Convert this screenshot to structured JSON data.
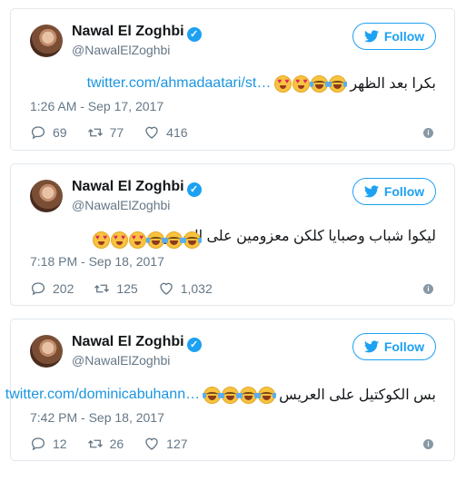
{
  "tweets": [
    {
      "name": "Nawal El Zoghbi",
      "handle": "@NawalElZoghbi",
      "follow_label": "Follow",
      "link": "twitter.com/ahmadaatari/st…",
      "text": "بكرا بعد الظهر",
      "emojis": [
        "heart-eyes-emoji",
        "heart-eyes-emoji",
        "tears-of-joy-emoji",
        "tears-of-joy-emoji"
      ],
      "time": "1:26 AM - Sep 17, 2017",
      "replies": "69",
      "retweets": "77",
      "likes": "416"
    },
    {
      "name": "Nawal El Zoghbi",
      "handle": "@NawalElZoghbi",
      "follow_label": "Follow",
      "link": "",
      "text": "ليكوا شباب وصبايا كلكن معزومين على العرس",
      "emojis": [
        "heart-eyes-emoji",
        "heart-eyes-emoji",
        "heart-eyes-emoji",
        "tears-of-joy-emoji",
        "tears-of-joy-emoji",
        "tears-of-joy-emoji"
      ],
      "time": "7:18 PM - Sep 18, 2017",
      "replies": "202",
      "retweets": "125",
      "likes": "1,032"
    },
    {
      "name": "Nawal El Zoghbi",
      "handle": "@NawalElZoghbi",
      "follow_label": "Follow",
      "link": "twitter.com/dominicabuhann…",
      "text": "بس الكوكتيل على العريس",
      "emojis": [
        "tears-of-joy-emoji",
        "tears-of-joy-emoji",
        "tears-of-joy-emoji",
        "tears-of-joy-emoji"
      ],
      "time": "7:42 PM - Sep 18, 2017",
      "replies": "12",
      "retweets": "26",
      "likes": "127"
    }
  ],
  "colors": {
    "accent": "#1da1f2",
    "link": "#1b95e0",
    "muted": "#657786",
    "border": "#e1e8ed"
  },
  "icons": {
    "reply": "reply-icon",
    "retweet": "retweet-icon",
    "like": "heart-icon",
    "info": "info-icon",
    "verified": "verified-badge-icon",
    "bird": "twitter-bird-icon"
  }
}
